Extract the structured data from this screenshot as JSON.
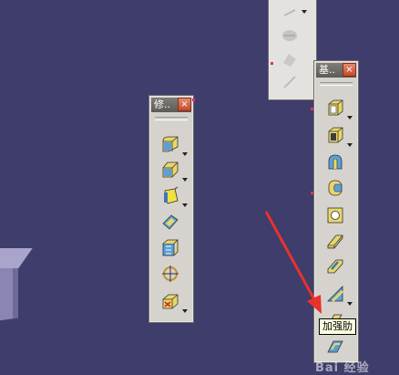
{
  "toolbar_modify": {
    "title": "修..",
    "close": "×"
  },
  "toolbar_basic": {
    "title": "基..",
    "close": "×"
  },
  "tooltip": {
    "text": "加强肋"
  },
  "watermark": {
    "text": "Bai 经验"
  },
  "icons_modify": [
    "edge-fillet-icon",
    "chamfer-icon",
    "draft-icon",
    "shell-icon",
    "thickness-icon",
    "thread-icon",
    "remove-face-icon"
  ],
  "icons_basic": [
    "pad-icon",
    "pocket-icon",
    "shaft-icon",
    "groove-icon",
    "hole-icon",
    "rib-icon",
    "slot-icon",
    "stiffener-icon",
    "solid-combine-icon",
    "multi-sections-icon"
  ],
  "colors": {
    "background": "#3f3d6b",
    "toolbar": "#d6d3ce",
    "title_bar": "#6e6c68",
    "close_button": "#d0573a",
    "arrow": "#e8322c"
  }
}
